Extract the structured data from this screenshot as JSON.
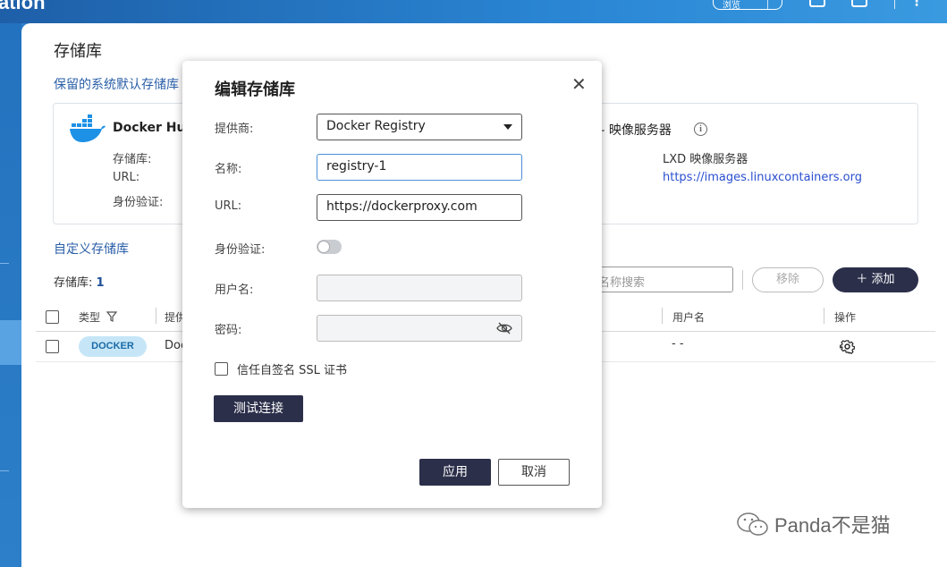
{
  "app": {
    "title_fragment": "ation",
    "top_button": "浏览"
  },
  "page": {
    "title": "存储库",
    "reserved_label": "保留的系统默认存储库",
    "custom_label": "自定义存储库"
  },
  "docker_card": {
    "name": "Docker Hub",
    "field_repo": "存储库:",
    "field_url": "URL:",
    "field_auth": "身份验证:"
  },
  "lxd_card": {
    "header": "器 – 映像服务器",
    "name": "LXD 映像服务器",
    "url": "https://images.linuxcontainers.org"
  },
  "list": {
    "count_label": "存储库:",
    "count_value": "1",
    "search_placeholder": "名称搜索",
    "remove_label": "移除",
    "add_label": "＋ 添加",
    "headers": {
      "type": "类型",
      "provider": "提供",
      "username": "用户名",
      "actions": "操作"
    },
    "rows": [
      {
        "type_badge": "DOCKER",
        "provider": "Doc",
        "username": "- -"
      }
    ]
  },
  "dialog": {
    "title": "编辑存储库",
    "provider_label": "提供商:",
    "provider_value": "Docker Registry",
    "name_label": "名称:",
    "name_value": "registry-1",
    "url_label": "URL:",
    "url_value": "https://dockerproxy.com",
    "auth_label": "身份验证:",
    "auth_enabled": false,
    "username_label": "用户名:",
    "password_label": "密码:",
    "ssl_label": "信任自签名 SSL 证书",
    "ssl_checked": false,
    "test_label": "测试连接",
    "apply_label": "应用",
    "cancel_label": "取消"
  },
  "watermark": {
    "text": "Panda不是猫"
  },
  "colors": {
    "accent": "#2b2f4a",
    "link": "#2a4fcf",
    "section_label": "#2a5fa8",
    "badge_bg": "#c6e6f7"
  }
}
